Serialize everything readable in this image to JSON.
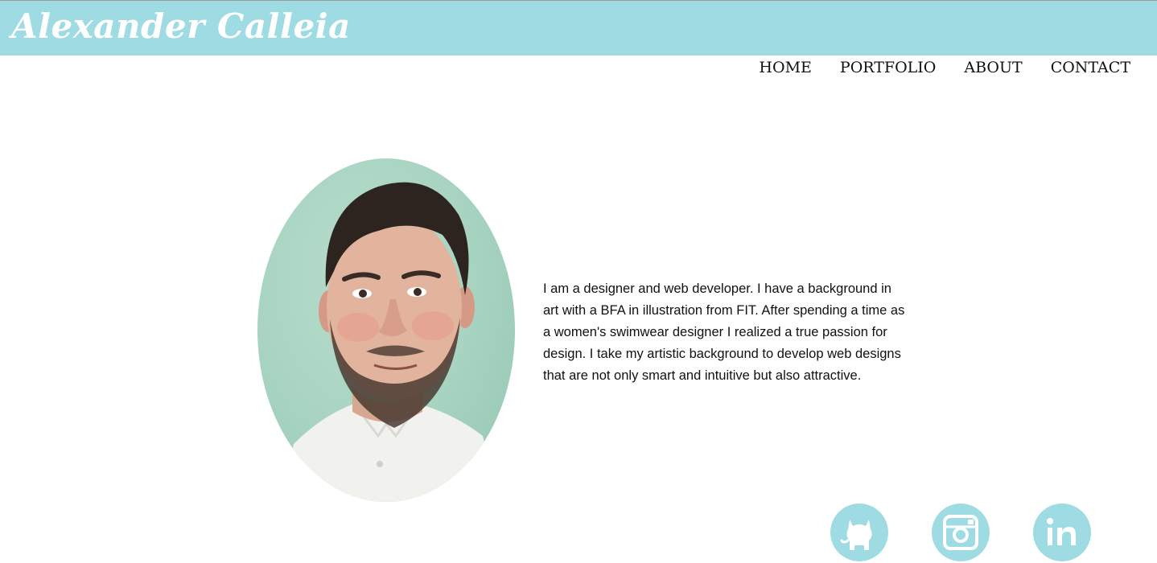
{
  "site": {
    "brand": "Alexander Calleia"
  },
  "nav": {
    "items": [
      {
        "label": "HOME"
      },
      {
        "label": "PORTFOLIO"
      },
      {
        "label": "ABOUT"
      },
      {
        "label": "CONTACT"
      }
    ]
  },
  "about": {
    "bio": "I am a designer and web developer. I have a background in art with a BFA in illustration from FIT. After spending a time as a women's swimwear designer I realized a true passion for design. I take my artistic background to develop web designs that are not only smart and intuitive but also attractive."
  },
  "social": {
    "icons": [
      "github-icon",
      "instagram-icon",
      "linkedin-icon"
    ]
  },
  "colors": {
    "accent": "#9fdbe3",
    "text": "#111111",
    "background": "#ffffff"
  }
}
